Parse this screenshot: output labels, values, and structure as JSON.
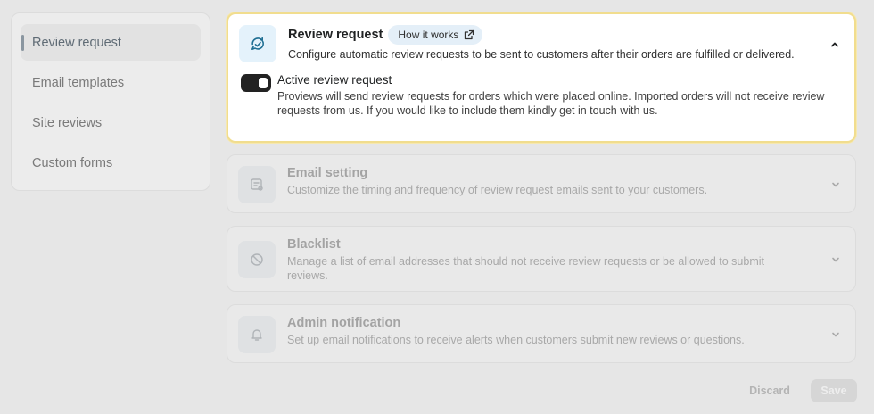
{
  "sidebar": {
    "items": [
      {
        "label": "Review request",
        "active": true
      },
      {
        "label": "Email templates"
      },
      {
        "label": "Site reviews"
      },
      {
        "label": "Custom forms"
      }
    ]
  },
  "cards": {
    "review_request": {
      "title": "Review request",
      "badge": "How it works",
      "description": "Configure automatic review requests to be sent to customers after their orders are fulfilled or delivered.",
      "toggle_label": "Active review request",
      "toggle_on": true,
      "toggle_description": "Proviews will send review requests for orders which were placed online. Imported orders will not receive review requests from us. If you would like to include them kindly get in touch with us.",
      "icon": "refresh-chat-icon"
    },
    "email_setting": {
      "title": "Email setting",
      "description": "Customize the timing and frequency of review request emails sent to your customers.",
      "icon": "email-settings-icon"
    },
    "blacklist": {
      "title": "Blacklist",
      "description": "Manage a list of email addresses that should not receive review requests or be allowed to submit reviews.",
      "icon": "ban-icon"
    },
    "admin_notification": {
      "title": "Admin notification",
      "description": "Set up email notifications to receive alerts when customers submit new reviews or questions.",
      "icon": "bell-icon"
    }
  },
  "footer": {
    "discard_label": "Discard",
    "save_label": "Save"
  },
  "colors": {
    "active_border": "#f1dd8e",
    "icon_accent": "#1f6f93",
    "page_bg": "#e6e6e6"
  }
}
